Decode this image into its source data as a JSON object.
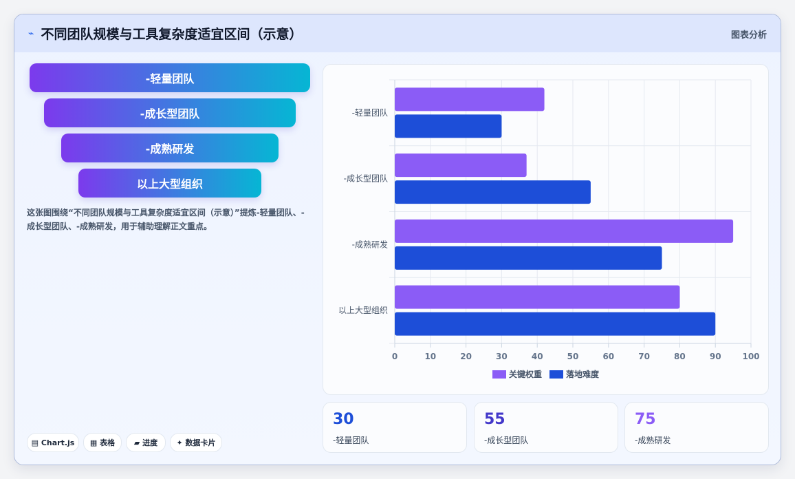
{
  "header": {
    "icon": "sparkle-icon",
    "title": "不同团队规模与工具复杂度适宜区间（示意）",
    "tag": "图表分析"
  },
  "funnel": [
    {
      "label": "-轻量团队"
    },
    {
      "label": "-成长型团队"
    },
    {
      "label": "-成熟研发"
    },
    {
      "label": "以上大型组织"
    }
  ],
  "description": "这张图围绕“不同团队规模与工具复杂度适宜区间（示意）”提炼-轻量团队、-成长型团队、-成熟研发，用于辅助理解正文重点。",
  "chart_data": {
    "type": "bar",
    "orientation": "horizontal",
    "categories": [
      "-轻量团队",
      "-成长型团队",
      "-成熟研发",
      "以上大型组织"
    ],
    "series": [
      {
        "name": "关键权重",
        "values": [
          42,
          37,
          95,
          80
        ],
        "color": "#8b5cf6"
      },
      {
        "name": "落地难度",
        "values": [
          30,
          55,
          75,
          90
        ],
        "color": "#1d4ed8"
      }
    ],
    "xlim": [
      0,
      100
    ],
    "xticks": [
      "0",
      "10",
      "20",
      "30",
      "40",
      "50",
      "60",
      "70",
      "80",
      "90",
      "100"
    ],
    "grid": true,
    "legend_position": "bottom"
  },
  "stats": [
    {
      "value": "30",
      "label": "-轻量团队",
      "color": "#1d4ed8"
    },
    {
      "value": "55",
      "label": "-成长型团队",
      "color": "#4338ca"
    },
    {
      "value": "75",
      "label": "-成熟研发",
      "color": "#8b5cf6"
    }
  ],
  "chips": [
    {
      "label": "▤ Chart.js"
    },
    {
      "label": "▦ 表格"
    },
    {
      "label": "▰ 进度"
    },
    {
      "label": "✦ 数据卡片"
    }
  ]
}
